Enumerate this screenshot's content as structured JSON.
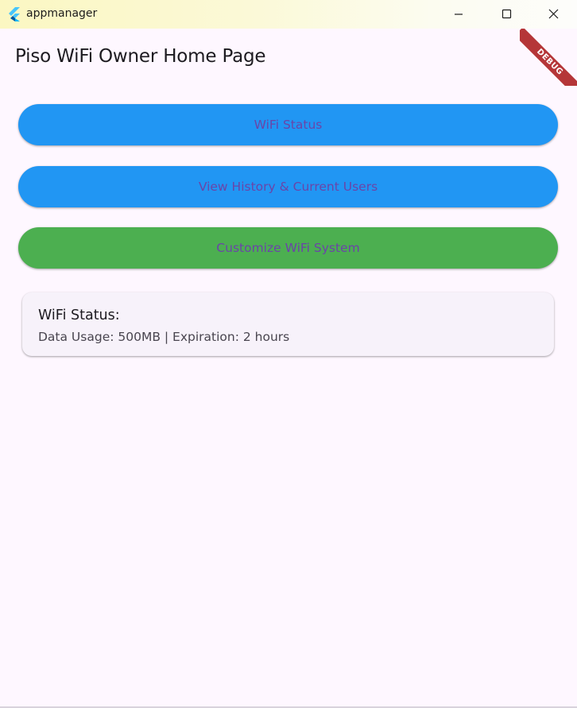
{
  "window": {
    "app_name": "appmanager",
    "app_icon": "flutter-logo-icon",
    "controls": {
      "minimize_icon": "minimize-icon",
      "maximize_icon": "maximize-icon",
      "close_icon": "close-icon"
    }
  },
  "debug_banner": {
    "label": "DEBUG"
  },
  "page": {
    "title": "Piso WiFi Owner Home Page"
  },
  "buttons": {
    "wifi_status": "WiFi Status",
    "view_history": "View History & Current Users",
    "customize": "Customize WiFi System"
  },
  "status_card": {
    "title": "WiFi Status:",
    "details": "Data Usage: 500MB | Expiration: 2 hours"
  },
  "colors": {
    "primary_button": "#2196f3",
    "customize_button": "#4caf50",
    "button_text": "#6a45a8",
    "background": "#fef7ff",
    "card_background": "#f7f2fa",
    "debug_ribbon": "#a00000"
  }
}
